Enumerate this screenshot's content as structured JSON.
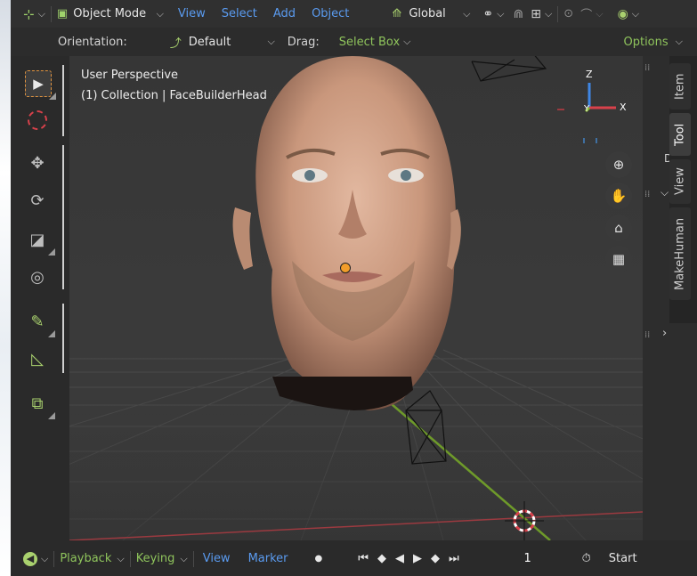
{
  "header": {
    "editor_type_icon": "editor-3d-viewport-icon",
    "mode_label": "Object Mode",
    "menus": [
      "View",
      "Select",
      "Add",
      "Object"
    ],
    "transform_orientation_label": "Global",
    "snap_icon": "snap-magnet-icon",
    "pivot_icon": "pivot-link-icon",
    "proportional_icon": "proportional-edit-icon",
    "falloff_icon": "falloff-curve-icon",
    "visibility_icon": "eye-visibility-icon"
  },
  "tool_header": {
    "orientation_label": "Orientation:",
    "orientation_value": "Default",
    "drag_label": "Drag:",
    "drag_value": "Select Box",
    "options_label": "Options"
  },
  "viewport": {
    "view_name": "User Perspective",
    "collection_info": "(1) Collection | FaceBuilderHead",
    "gizmo_axes": [
      "Z",
      "Y",
      "X"
    ]
  },
  "side_tabs": [
    "Item",
    "Tool",
    "View",
    "MakeHuman"
  ],
  "tool_settings_partial": "D",
  "timeline": {
    "playback_label": "Playback",
    "keying_label": "Keying",
    "view_label": "View",
    "marker_label": "Marker",
    "current_frame": "1",
    "start_label": "Start"
  },
  "colors": {
    "accent_blue": "#5a9bf0",
    "accent_green": "#8fc45c",
    "axis_x": "#d8414b",
    "axis_y": "#8bbc30",
    "axis_z": "#3f86e4"
  }
}
